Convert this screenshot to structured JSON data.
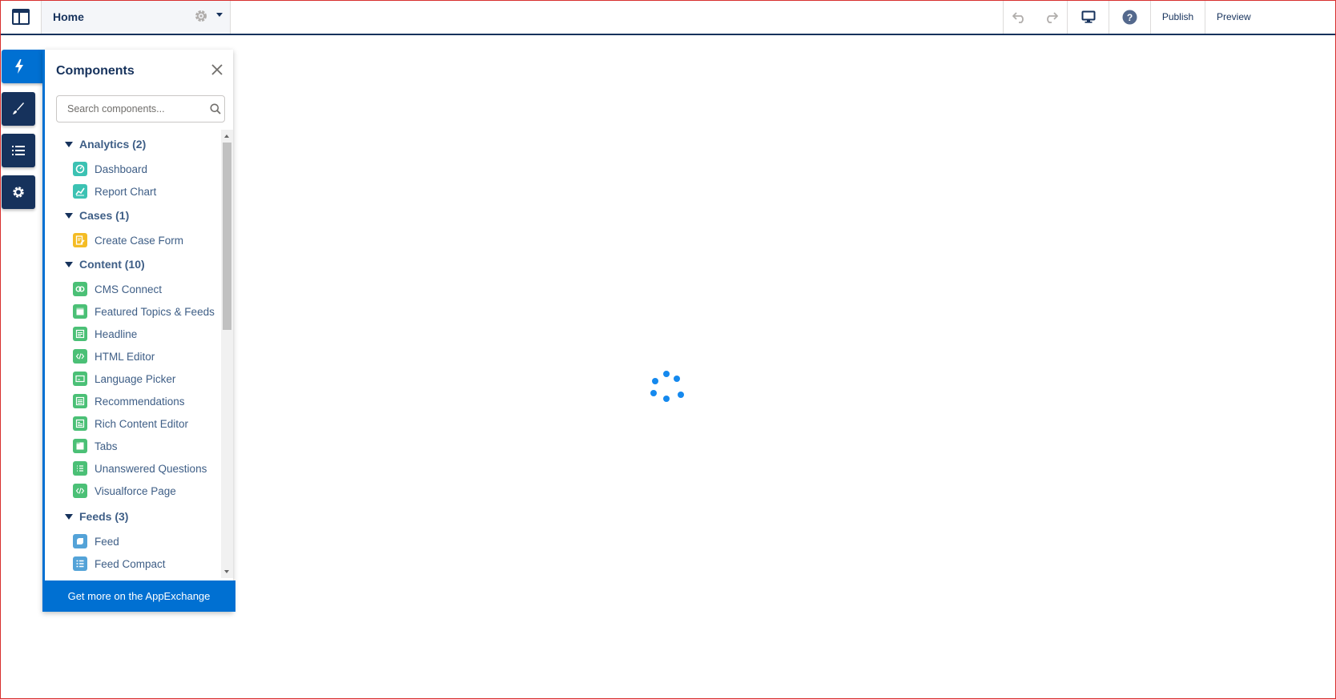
{
  "topbar": {
    "page_title": "Home",
    "publish_label": "Publish",
    "preview_label": "Preview",
    "icons": {
      "app": "layout-icon",
      "page_settings": "gear-icon",
      "dropdown": "chevron-down-icon",
      "undo": "undo-icon",
      "redo": "redo-icon",
      "device": "desktop-icon",
      "help": "help-icon"
    }
  },
  "rail": {
    "items": [
      {
        "name": "components",
        "icon": "lightning-icon",
        "active": true
      },
      {
        "name": "theme",
        "icon": "brush-icon",
        "active": false
      },
      {
        "name": "page-structure",
        "icon": "list-icon",
        "active": false
      },
      {
        "name": "settings",
        "icon": "gear-icon",
        "active": false
      }
    ]
  },
  "panel": {
    "title": "Components",
    "search_placeholder": "Search components...",
    "groups": [
      {
        "label": "Analytics (2)",
        "items": [
          "Dashboard",
          "Report Chart"
        ]
      },
      {
        "label": "Cases (1)",
        "items": [
          "Create Case Form"
        ]
      },
      {
        "label": "Content (10)",
        "items": [
          "CMS Connect",
          "Featured Topics & Feeds",
          "Headline",
          "HTML Editor",
          "Language Picker",
          "Recommendations",
          "Rich Content Editor",
          "Tabs",
          "Unanswered Questions",
          "Visualforce Page"
        ]
      },
      {
        "label": "Feeds (3)",
        "items": [
          "Feed",
          "Feed Compact"
        ]
      }
    ],
    "appexchange_label": "Get more on the AppExchange"
  },
  "colors": {
    "brand_blue": "#0070d2",
    "navy": "#16325c",
    "spinner": "#1589ee",
    "analytics_teal": "#3cc2b3",
    "cases_yellow": "#f4bc25",
    "content_green": "#4bc076",
    "feeds_blue": "#54a3d8"
  }
}
